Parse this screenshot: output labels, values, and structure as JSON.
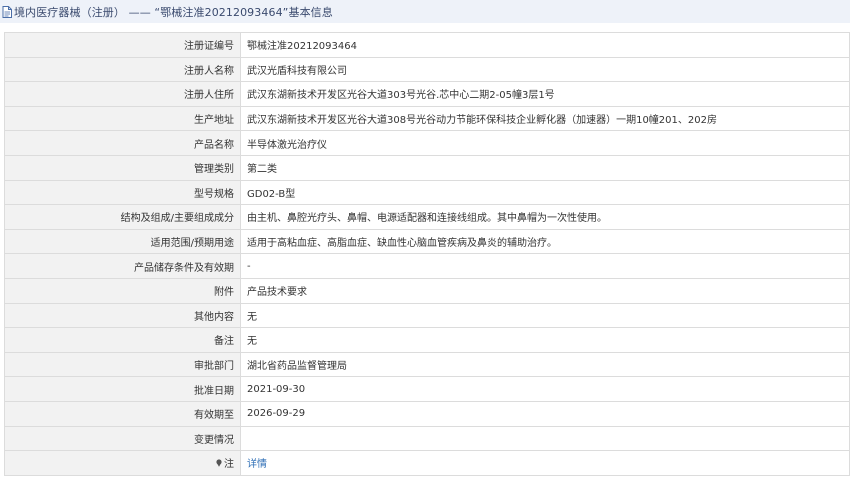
{
  "header": {
    "title": "境内医疗器械（注册） —— “鄂械注准20212093464”基本信息",
    "icon": "document-icon"
  },
  "rows": [
    {
      "label": "注册证编号",
      "value": "鄂械注准20212093464"
    },
    {
      "label": "注册人名称",
      "value": "武汉光盾科技有限公司"
    },
    {
      "label": "注册人住所",
      "value": "武汉东湖新技术开发区光谷大道303号光谷.芯中心二期2-05幢3层1号"
    },
    {
      "label": "生产地址",
      "value": "武汉东湖新技术开发区光谷大道308号光谷动力节能环保科技企业孵化器（加速器）一期10幢201、202房"
    },
    {
      "label": "产品名称",
      "value": "半导体激光治疗仪"
    },
    {
      "label": "管理类别",
      "value": "第二类"
    },
    {
      "label": "型号规格",
      "value": "GD02-B型"
    },
    {
      "label": "结构及组成/主要组成成分",
      "value": "由主机、鼻腔光疗头、鼻帽、电源适配器和连接线组成。其中鼻帽为一次性使用。"
    },
    {
      "label": "适用范围/预期用途",
      "value": "适用于高粘血症、高脂血症、缺血性心脑血管疾病及鼻炎的辅助治疗。"
    },
    {
      "label": "产品储存条件及有效期",
      "value": "-"
    },
    {
      "label": "附件",
      "value": "产品技术要求"
    },
    {
      "label": "其他内容",
      "value": "无"
    },
    {
      "label": "备注",
      "value": "无"
    },
    {
      "label": "审批部门",
      "value": "湖北省药品监督管理局"
    },
    {
      "label": "批准日期",
      "value": "2021-09-30"
    },
    {
      "label": "有效期至",
      "value": "2026-09-29"
    },
    {
      "label": "变更情况",
      "value": ""
    }
  ],
  "note_row": {
    "label": "注",
    "icon": "pin-icon",
    "link_text": "详情"
  },
  "colors": {
    "header_bg": "#eef2f9",
    "label_bg": "#f2f2f2",
    "border": "#dcdcdc",
    "link": "#2f6fb6"
  }
}
